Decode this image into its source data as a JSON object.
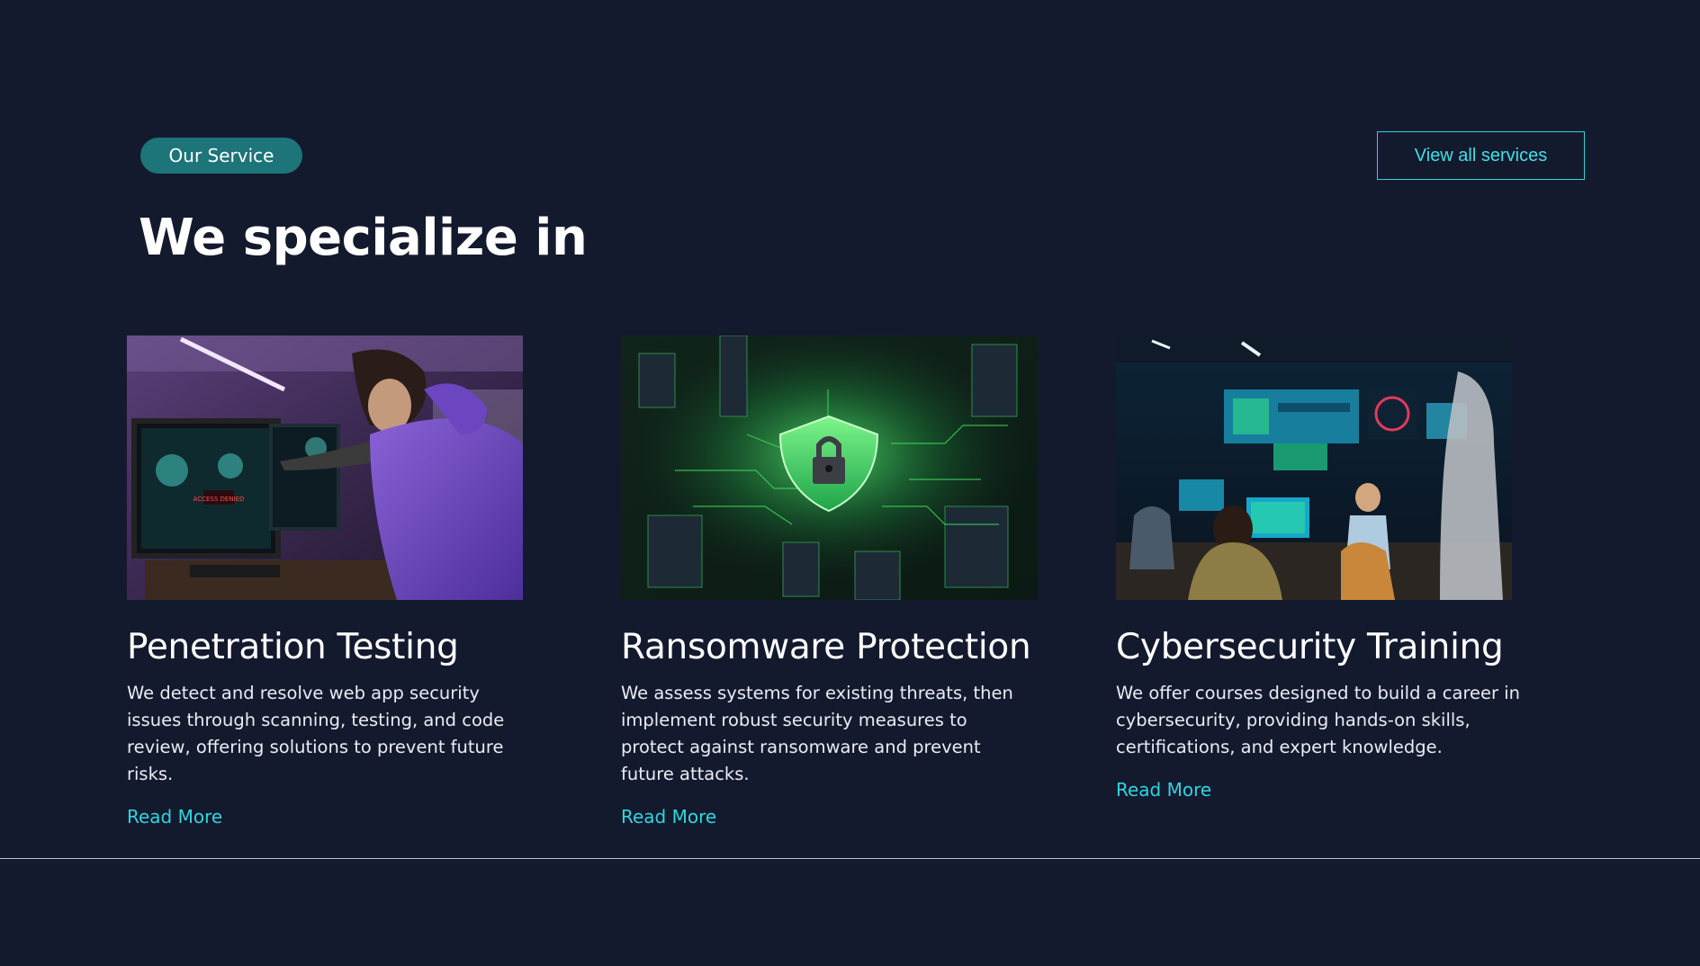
{
  "header": {
    "badge": "Our Service",
    "title": "We specialize in",
    "view_all_label": "View all services"
  },
  "services": [
    {
      "title": "Penetration Testing",
      "description": "We detect and resolve web app security issues through scanning, testing, and code review, offering solutions to prevent future risks.",
      "link_label": "Read More",
      "screen_text": "ACCESS DENIED"
    },
    {
      "title": "Ransomware Protection",
      "description": "We assess systems for existing threats, then implement robust security measures to protect against ransomware and prevent future attacks.",
      "link_label": "Read More"
    },
    {
      "title": "Cybersecurity Training",
      "description": "We offer courses designed to build a career in cybersecurity, providing hands-on skills, certifications, and expert knowledge.",
      "link_label": "Read More"
    }
  ],
  "colors": {
    "background": "#141a2e",
    "badge_bg": "#1d7479",
    "accent": "#2fd6df",
    "divider": "#b9c0cf"
  }
}
